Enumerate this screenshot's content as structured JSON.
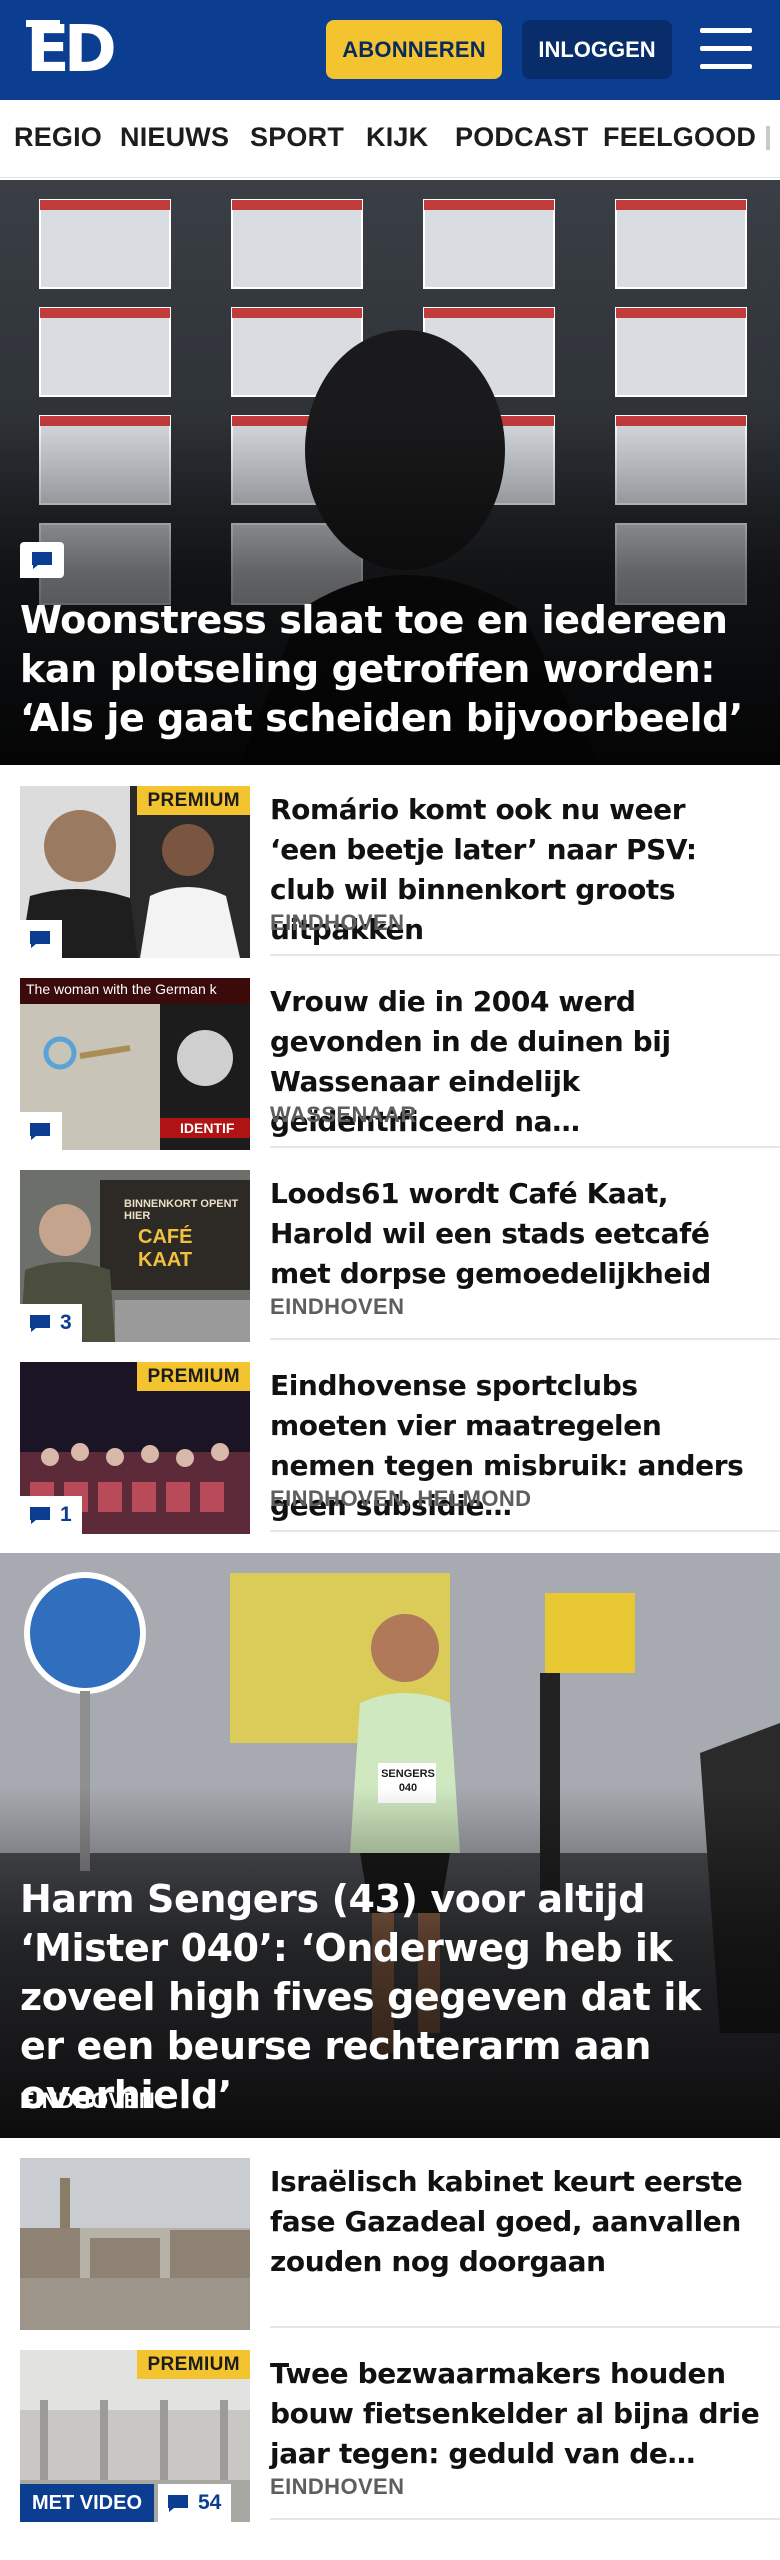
{
  "header": {
    "logo_text": "ED",
    "subscribe_label": "ABONNEREN",
    "login_label": "INLOGGEN",
    "menu_icon": "hamburger-menu-icon",
    "brand_color": "#0b3d91",
    "accent_color": "#f4c430"
  },
  "nav": {
    "items": [
      "REGIO",
      "NIEUWS",
      "SPORT",
      "KIJK",
      "PODCAST",
      "FEELGOOD"
    ]
  },
  "hero1": {
    "title": "Woonstress slaat toe en iedereen kan plotseling getroffen worden: ‘Als je gaat scheiden bijvoorbeeld’",
    "comment_icon": "comment-icon"
  },
  "articles1": [
    {
      "title": "Romário komt ook nu weer ‘een beetje later’ naar PSV: club wil binnenkort groots uitpakken",
      "location": "EINDHOVEN",
      "premium": "PREMIUM",
      "comments": ""
    },
    {
      "title": "Vrouw die in 2004 werd gevonden in de duinen bij Wassenaar eindelijk geïdentificeerd na…",
      "location": "WASSENAAR",
      "premium": "",
      "comments": "",
      "thumb_text": "The woman with the German k",
      "thumb_text2": "IDENTIF"
    },
    {
      "title": "Loods61 wordt Café Kaat, Harold wil een stads eetcafé met dorpse gemoedelijkheid",
      "location": "EINDHOVEN",
      "premium": "",
      "comments": "3",
      "thumb_text": "BINNENKORT OPENT HIER",
      "thumb_text2": "CAFÉ KAAT"
    },
    {
      "title": "Eindhovense sportclubs moeten vier maatregelen nemen tegen misbruik: anders geen subsidie…",
      "location": "EINDHOVEN, HELMOND",
      "premium": "PREMIUM",
      "comments": "1"
    }
  ],
  "hero2": {
    "title": "Harm Sengers (43) voor altijd ‘Mister 040’: ‘Onderweg heb ik zoveel high fives gegeven dat ik er een beurse rechterarm aan overhield’",
    "location": "EINDHOVEN",
    "bib": "SENGERS 040"
  },
  "articles2": [
    {
      "title": "Israëlisch kabinet keurt eerste fase Gazadeal goed, aanvallen zouden nog doorgaan",
      "location": "",
      "premium": "",
      "comments": ""
    },
    {
      "title": "Twee bezwaarmakers houden bouw fietsenkelder al bijna drie jaar tegen: geduld van de…",
      "location": "EINDHOVEN",
      "premium": "PREMIUM",
      "comments": "54",
      "video": "MET VIDEO"
    }
  ]
}
